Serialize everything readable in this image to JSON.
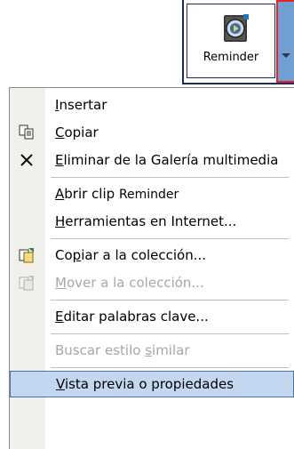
{
  "clip": {
    "label": "Reminder",
    "icon": "media-clip-icon",
    "dropdown_icon": "chevron-down-icon"
  },
  "menu": {
    "items": [
      {
        "id": "insertar",
        "hot": "I",
        "rest": "nsertar",
        "disabled": false,
        "icon": null
      },
      {
        "id": "copiar",
        "hot": "C",
        "rest": "opiar",
        "disabled": false,
        "icon": "copy-icon"
      },
      {
        "id": "eliminar",
        "hot": "E",
        "rest": "liminar de la Galería multimedia",
        "disabled": false,
        "icon": "delete-x-icon"
      },
      {
        "id": "abrir",
        "pre": "",
        "hot": "A",
        "rest": "brir clip ",
        "suffix": "Reminder",
        "disabled": false,
        "icon": null
      },
      {
        "id": "herramientas",
        "hot": "H",
        "rest": "erramientas en Internet...",
        "disabled": false,
        "icon": null
      },
      {
        "id": "copiar-coleccion",
        "pre": "Co",
        "hot": "p",
        "rest": "iar a la colección...",
        "disabled": false,
        "icon": "copy-to-collection-icon"
      },
      {
        "id": "mover-coleccion",
        "hot": "M",
        "rest": "over a la colección...",
        "disabled": true,
        "icon": "move-to-collection-icon"
      },
      {
        "id": "editar",
        "hot": "E",
        "rest": "ditar palabras clave...",
        "disabled": false,
        "icon": null
      },
      {
        "id": "buscar",
        "pre": "Buscar estilo ",
        "hot": "s",
        "rest": "imilar",
        "disabled": true,
        "icon": null
      },
      {
        "id": "vista",
        "hot": "V",
        "rest": "ista previa o propiedades",
        "disabled": false,
        "highlighted": true,
        "icon": null
      }
    ]
  },
  "colors": {
    "highlight_bg": "#c3d7f0",
    "highlight_border": "#4b6fa6",
    "dropdown_bg": "#6f9fd3",
    "dropdown_border": "#e2232a",
    "disabled_text": "#a7a7a7"
  }
}
